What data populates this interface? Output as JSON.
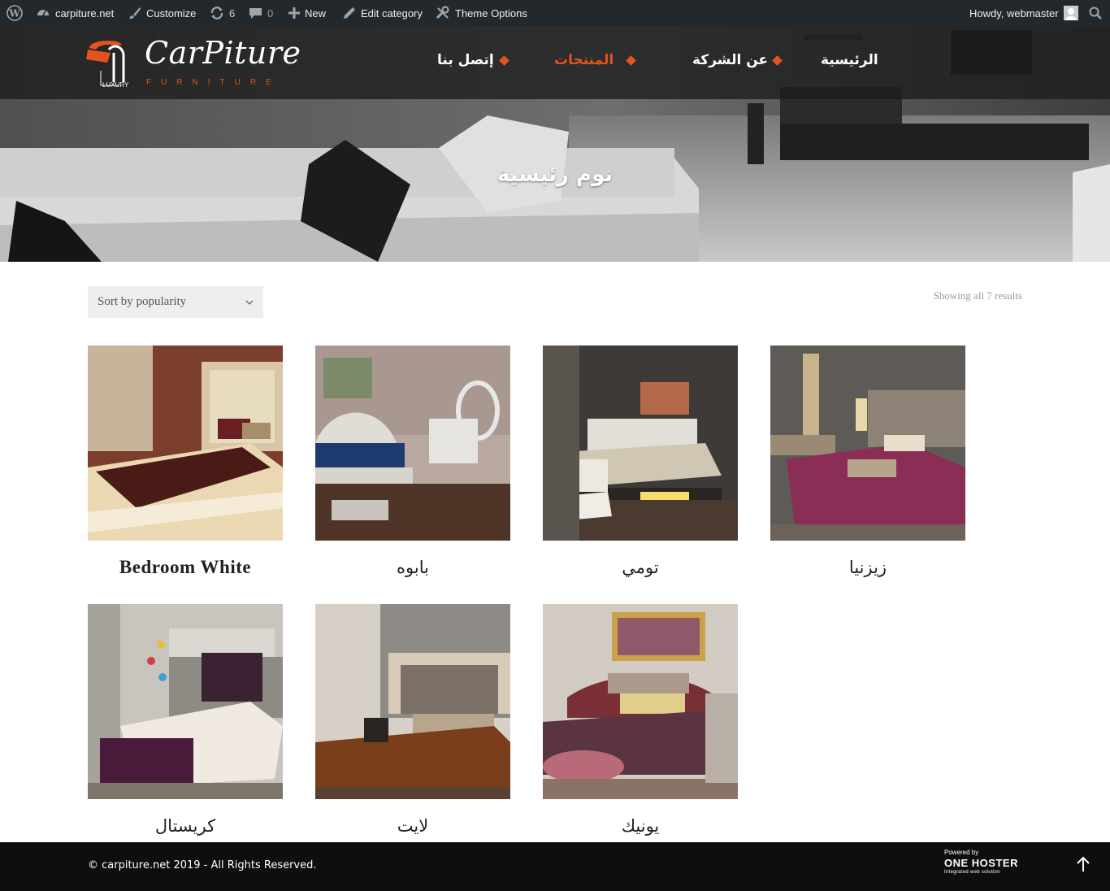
{
  "adminbar": {
    "wp_icon": "wordpress-icon",
    "site_name": "carpiture.net",
    "customize": "Customize",
    "updates_count": "6",
    "comments_count": "0",
    "new_label": "New",
    "edit_label": "Edit category",
    "theme_options": "Theme Options",
    "howdy": "Howdy, webmaster",
    "search_icon": "search-icon"
  },
  "header": {
    "logo_script": "CarPiture",
    "logo_sub": "FURNITURE",
    "logo_luxury": "LUXURY",
    "nav": [
      {
        "label": "الرئيسية",
        "active": false
      },
      {
        "label": "عن الشركة",
        "active": false
      },
      {
        "label": "المنتجات",
        "active": true
      },
      {
        "label": "إتصل بنا",
        "active": false
      }
    ],
    "accent_color": "#e4531f"
  },
  "page": {
    "title": "نوم رئيسية"
  },
  "shop": {
    "sort_label": "Sort by popularity",
    "results_text": "Showing all 7 results",
    "products": [
      {
        "name": "Bedroom White"
      },
      {
        "name": "بابوه"
      },
      {
        "name": "تومي"
      },
      {
        "name": "زيزنيا"
      },
      {
        "name": "كريستال"
      },
      {
        "name": "لايت"
      },
      {
        "name": "يونيك"
      }
    ]
  },
  "footer": {
    "copyright": "© carpiture.net 2019 - All Rights Reserved.",
    "powered_by": "Powered by",
    "brand": "ONE HOSTER",
    "tagline": "Integrated web solution",
    "to_top_icon": "arrow-up-icon"
  }
}
